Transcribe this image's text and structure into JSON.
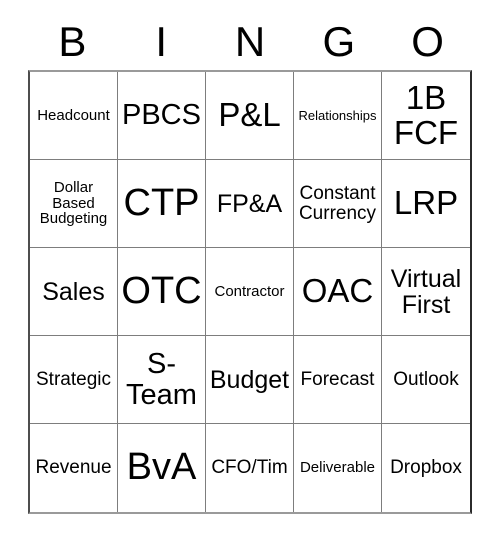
{
  "card": {
    "title": "BINGO",
    "header_letters": [
      "B",
      "I",
      "N",
      "G",
      "O"
    ],
    "grid_size": "5x5",
    "colors": {
      "background": "#ffffff",
      "text": "#000000",
      "cell_border": "#7d7d7d",
      "outer_border": "#4d4d4d"
    },
    "rows": [
      [
        {
          "label": "Headcount",
          "size": "xs"
        },
        {
          "label": "PBCS",
          "size": "lg"
        },
        {
          "label": "P&L",
          "size": "xl"
        },
        {
          "label": "Relationships",
          "size": "xxs"
        },
        {
          "label": "1B FCF",
          "size": "xl"
        }
      ],
      [
        {
          "label": "Dollar Based Budgeting",
          "size": "xs"
        },
        {
          "label": "CTP",
          "size": "xxl"
        },
        {
          "label": "FP&A",
          "size": "md"
        },
        {
          "label": "Constant Currency",
          "size": "sm"
        },
        {
          "label": "LRP",
          "size": "xl"
        }
      ],
      [
        {
          "label": "Sales",
          "size": "md"
        },
        {
          "label": "OTC",
          "size": "xxl"
        },
        {
          "label": "Contractor",
          "size": "xs"
        },
        {
          "label": "OAC",
          "size": "xl"
        },
        {
          "label": "Virtual First",
          "size": "md"
        }
      ],
      [
        {
          "label": "Strategic",
          "size": "sm"
        },
        {
          "label": "S-Team",
          "size": "lg"
        },
        {
          "label": "Budget",
          "size": "md"
        },
        {
          "label": "Forecast",
          "size": "sm"
        },
        {
          "label": "Outlook",
          "size": "sm"
        }
      ],
      [
        {
          "label": "Revenue",
          "size": "sm"
        },
        {
          "label": "BvA",
          "size": "xxl"
        },
        {
          "label": "CFO/Tim",
          "size": "sm"
        },
        {
          "label": "Deliverable",
          "size": "xs"
        },
        {
          "label": "Dropbox",
          "size": "sm"
        }
      ]
    ]
  }
}
